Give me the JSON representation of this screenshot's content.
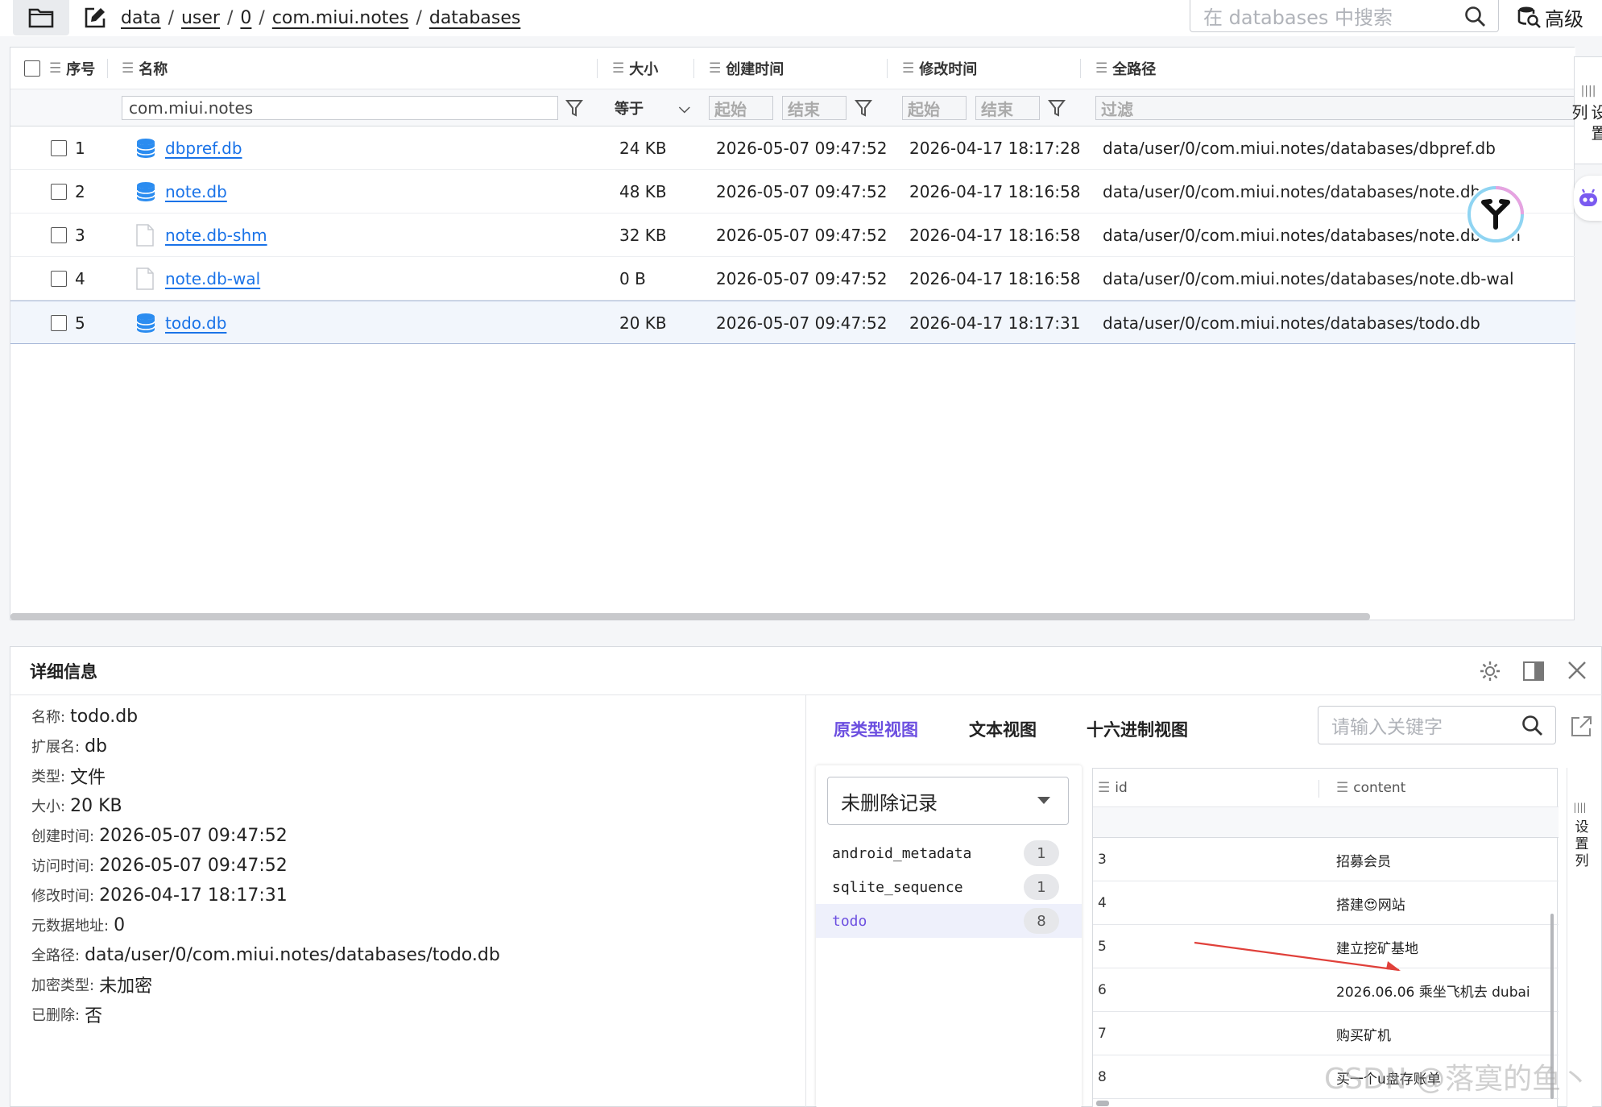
{
  "toolbar": {
    "breadcrumb": [
      "data",
      "user",
      "0",
      "com.miui.notes",
      "databases"
    ],
    "search_placeholder": "在 databases 中搜索",
    "advanced_label": "高级"
  },
  "table": {
    "columns": [
      "序号",
      "名称",
      "大小",
      "创建时间",
      "修改时间",
      "全路径"
    ],
    "filters": {
      "name_value": "com.miui.notes",
      "size_op": "等于",
      "created_start": "起始",
      "created_end": "结束",
      "modified_start": "起始",
      "modified_end": "结束",
      "path_placeholder": "过滤"
    },
    "rows": [
      {
        "no": "1",
        "name": "dbpref.db",
        "icon": "database-icon",
        "size": "24 KB",
        "created": "2026-05-07 09:47:52",
        "modified": "2026-04-17 18:17:28",
        "path": "data/user/0/com.miui.notes/databases/dbpref.db"
      },
      {
        "no": "2",
        "name": "note.db",
        "icon": "database-icon",
        "size": "48 KB",
        "created": "2026-05-07 09:47:52",
        "modified": "2026-04-17 18:16:58",
        "path": "data/user/0/com.miui.notes/databases/note.db"
      },
      {
        "no": "3",
        "name": "note.db-shm",
        "icon": "file-icon",
        "size": "32 KB",
        "created": "2026-05-07 09:47:52",
        "modified": "2026-04-17 18:16:58",
        "path": "data/user/0/com.miui.notes/databases/note.db-shm"
      },
      {
        "no": "4",
        "name": "note.db-wal",
        "icon": "file-icon",
        "size": "0 B",
        "created": "2026-05-07 09:47:52",
        "modified": "2026-04-17 18:16:58",
        "path": "data/user/0/com.miui.notes/databases/note.db-wal"
      },
      {
        "no": "5",
        "name": "todo.db",
        "icon": "database-icon",
        "size": "20 KB",
        "created": "2026-05-07 09:47:52",
        "modified": "2026-04-17 18:17:31",
        "path": "data/user/0/com.miui.notes/databases/todo.db"
      }
    ],
    "selected_row": "5",
    "set_columns_label": "设置列"
  },
  "details": {
    "title": "详细信息",
    "fields": [
      {
        "key": "名称:",
        "value": "todo.db"
      },
      {
        "key": "扩展名:",
        "value": "db"
      },
      {
        "key": "类型:",
        "value": "文件"
      },
      {
        "key": "大小:",
        "value": "20 KB"
      },
      {
        "key": "创建时间:",
        "value": "2026-05-07 09:47:52"
      },
      {
        "key": "访问时间:",
        "value": "2026-05-07 09:47:52"
      },
      {
        "key": "修改时间:",
        "value": "2026-04-17 18:17:31"
      },
      {
        "key": "元数据地址:",
        "value": "0"
      },
      {
        "key": "全路径:",
        "value": "data/user/0/com.miui.notes/databases/todo.db"
      },
      {
        "key": "加密类型:",
        "value": "未加密"
      },
      {
        "key": "已删除:",
        "value": "否"
      }
    ],
    "tabs": [
      "原类型视图",
      "文本视图",
      "十六进制视图"
    ],
    "active_tab": "原类型视图",
    "keyword_placeholder": "请输入关键字",
    "record_filter": "未删除记录",
    "db_tables": [
      {
        "name": "android_metadata",
        "count": "1"
      },
      {
        "name": "sqlite_sequence",
        "count": "1"
      },
      {
        "name": "todo",
        "count": "8"
      }
    ],
    "active_table": "todo",
    "record_columns": [
      "id",
      "content"
    ],
    "records": [
      {
        "id": "3",
        "content": "招募会员"
      },
      {
        "id": "4",
        "content": "搭建😍网站"
      },
      {
        "id": "5",
        "content": "建立挖矿基地"
      },
      {
        "id": "6",
        "content": "2026.06.06 乘坐飞机去 dubai"
      },
      {
        "id": "7",
        "content": "购买矿机"
      },
      {
        "id": "8",
        "content": "买一个u盘存账单"
      }
    ],
    "set_columns_label": "设置列"
  },
  "watermark": "CSDN @落寞的鱼丶",
  "colors": {
    "accent": "#6c4fe0",
    "link": "#1a73e8",
    "db_icon": "#2b8cf0",
    "arrow": "#e0403a"
  }
}
